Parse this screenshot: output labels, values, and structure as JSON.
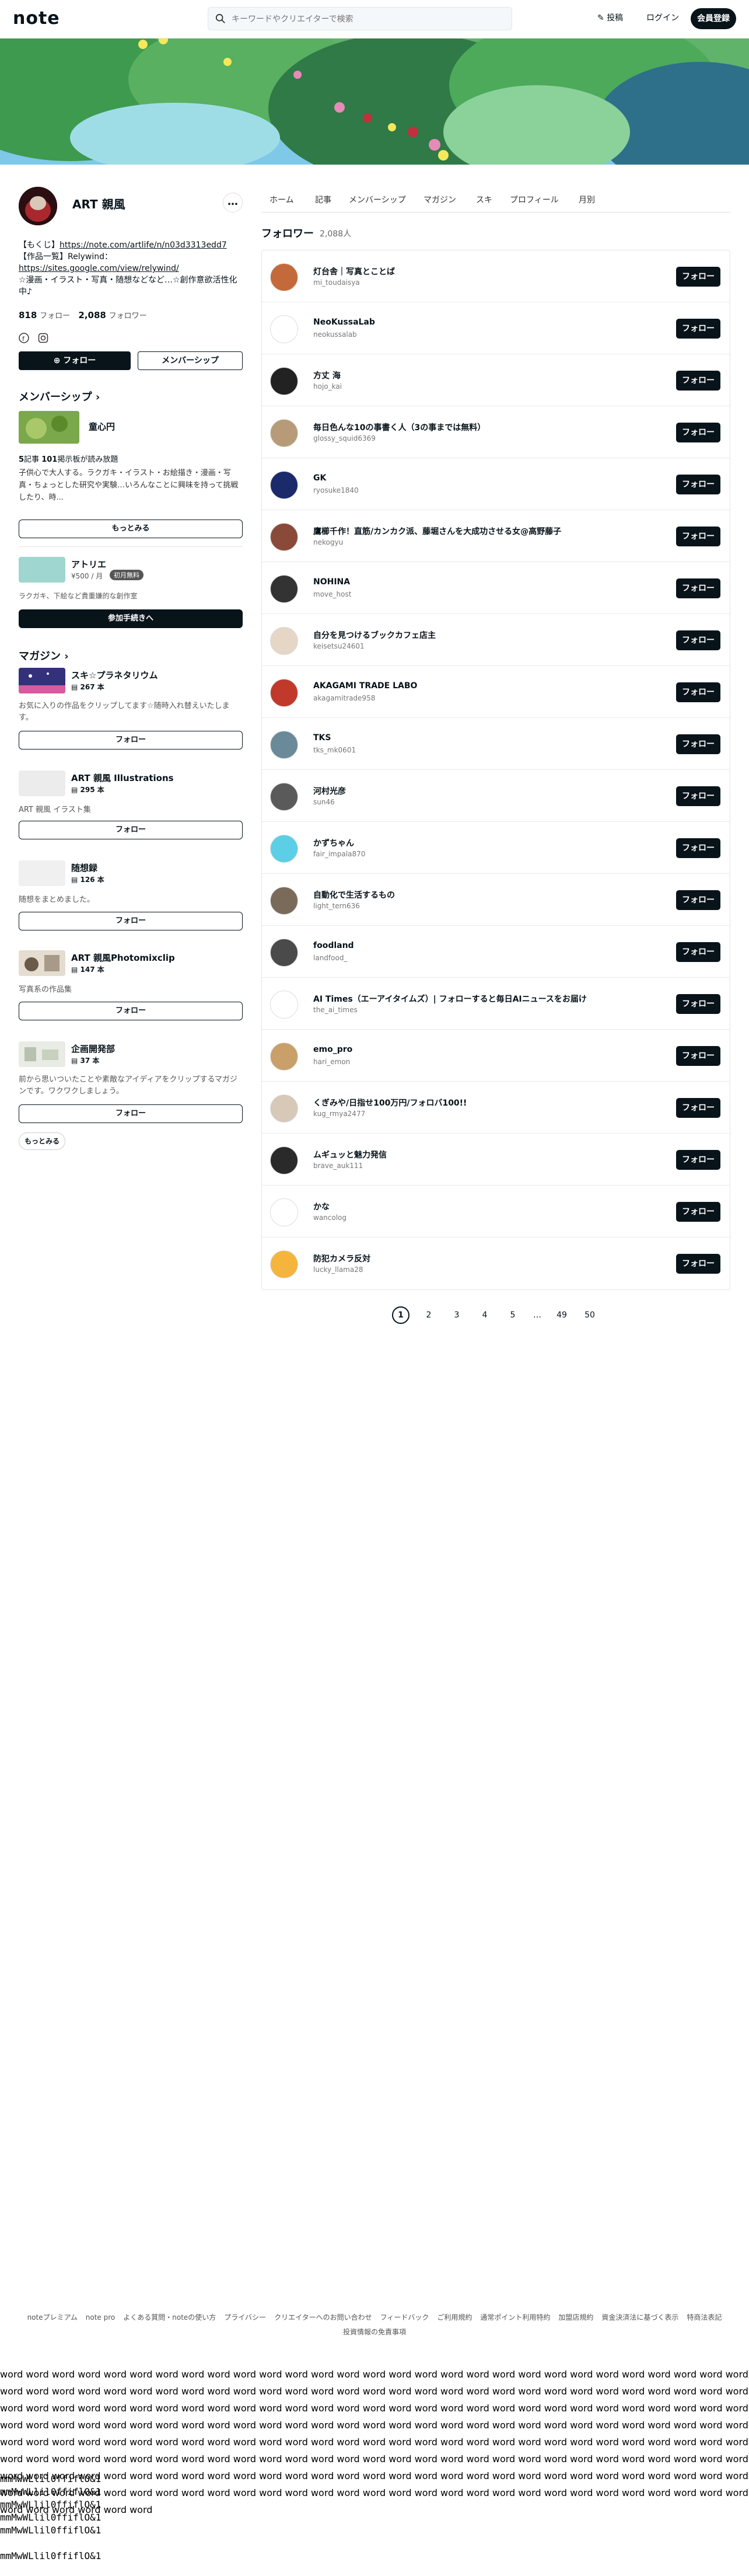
{
  "header": {
    "logo": "note",
    "search_placeholder": "キーワードやクリエイターで検索",
    "post_label": "投稿",
    "login_label": "ログイン",
    "signup_label": "会員登録"
  },
  "profile": {
    "name": "ART 親風",
    "bio_line1_prefix": "【もくじ】",
    "bio_link1": "https://note.com/artlife/n/n03d3313edd7",
    "bio_line2": "【作品一覧】Relywind：",
    "bio_link2": "https://sites.google.com/view/relywind/",
    "bio_line3": "☆漫画・イラスト・写真・随想などなど…☆創作意欲活性化中♪",
    "following_count": "818",
    "following_label": "フォロー",
    "followers_count": "2,088",
    "followers_label": "フォロワー",
    "follow_button": "フォロー",
    "membership_button": "メンバーシップ"
  },
  "membership": {
    "heading": "メンバーシップ",
    "plan_title": "童心円",
    "plan_stats_articles": "5",
    "plan_stats_articles_label": "記事",
    "plan_stats_members": "101",
    "plan_stats_members_label": "掲示板",
    "plan_stats_suffix": "が読み放題",
    "plan_desc": "子供心で大人する。ラクガキ・イラスト・お絵描き・漫画・写真・ちょっとした研究や実験…いろんなことに興味を持って挑戦したり、時...",
    "more_button": "もっとみる",
    "tier_name": "アトリエ",
    "tier_price": "¥500 / 月",
    "tier_badge": "初月無料",
    "tier_desc": "ラクガキ、下絵など貴重嫌的な創作室",
    "join_button": "参加手続きへ"
  },
  "magazines": {
    "heading": "マガジン",
    "items": [
      {
        "title": "スキ☆プラネタリウム",
        "count": "267 本",
        "desc": "お気に入りの作品をクリップしてます☆随時入れ替えいたします。",
        "follow": "フォロー"
      },
      {
        "title": "ART 親風 Illustrations",
        "count": "295 本",
        "desc": "ART 親風 イラスト集",
        "follow": "フォロー"
      },
      {
        "title": "随想録",
        "count": "126 本",
        "desc": "随想をまとめました。",
        "follow": "フォロー"
      },
      {
        "title": "ART 親風Photomixclip",
        "count": "147 本",
        "desc": "写真系の作品集",
        "follow": "フォロー"
      },
      {
        "title": "企画開発部",
        "count": "37 本",
        "desc": "前から思いついたことや素敵なアイディアをクリップするマガジンです。ワクワクしましょう。",
        "follow": "フォロー"
      }
    ],
    "more_button": "もっとみる"
  },
  "tabs": [
    "ホーム",
    "記事",
    "メンバーシップ",
    "マガジン",
    "スキ",
    "プロフィール",
    "月別"
  ],
  "followers": {
    "heading": "フォロワー",
    "count": "2,088人",
    "items": [
      {
        "name": "灯台舎｜写真とことば",
        "id": "mi_toudaisya",
        "btn": "フォロー",
        "color": "#c46a3a"
      },
      {
        "name": "NeoKussaLab",
        "id": "neokussalab",
        "btn": "フォロー",
        "color": "#ffffff"
      },
      {
        "name": "方丈 海",
        "id": "hojo_kai",
        "btn": "フォロー",
        "color": "#222222"
      },
      {
        "name": "毎日色んな10の事書く人（3の事までは無料）",
        "id": "glossy_squid6369",
        "btn": "フォロー",
        "color": "#b79b78"
      },
      {
        "name": "GK",
        "id": "ryosuke1840",
        "btn": "フォロー",
        "color": "#1a2a6a"
      },
      {
        "name": "鷹櫛千作！直筋/カンカク派、藤堀さんを大成功させる女@高野藤子",
        "id": "nekogyu",
        "btn": "フォロー",
        "color": "#8a4a3a"
      },
      {
        "name": "NOHINA",
        "id": "move_host",
        "btn": "フォロー",
        "color": "#333333"
      },
      {
        "name": "自分を見つけるブックカフェ店主",
        "id": "keisetsu24601",
        "btn": "フォロー",
        "color": "#e6d6c6"
      },
      {
        "name": "AKAGAMI TRADE LABO",
        "id": "akagamitrade958",
        "btn": "フォロー",
        "color": "#c0392b"
      },
      {
        "name": "TKS",
        "id": "tks_mk0601",
        "btn": "フォロー",
        "color": "#6a8a9a"
      },
      {
        "name": "河村光彦",
        "id": "sun46",
        "btn": "フォロー",
        "color": "#5a5a5a"
      },
      {
        "name": "かずちゃん",
        "id": "fair_impala870",
        "btn": "フォロー",
        "color": "#5ccfe6"
      },
      {
        "name": "自動化で生活するもの",
        "id": "light_tern636",
        "btn": "フォロー",
        "color": "#7a6a5a"
      },
      {
        "name": "foodland",
        "id": "landfood_",
        "btn": "フォロー",
        "color": "#4a4a4a"
      },
      {
        "name": "AI Times（エーアイタイムズ）| フォローすると毎日AIニュースをお届け",
        "id": "the_ai_times",
        "btn": "フォロー",
        "color": "#ffffff"
      },
      {
        "name": "emo_pro",
        "id": "hari_emon",
        "btn": "フォロー",
        "color": "#c9a06a"
      },
      {
        "name": "くぎみや/日指せ100万円/フォロバ100!!",
        "id": "kug_rmya2477",
        "btn": "フォロー",
        "color": "#d8c8b8"
      },
      {
        "name": "ムギュッと魅力発信",
        "id": "brave_auk111",
        "btn": "フォロー",
        "color": "#2a2a2a"
      },
      {
        "name": "かな",
        "id": "wancolog",
        "btn": "フォロー",
        "color": "#ffffff"
      },
      {
        "name": "防犯カメラ反対",
        "id": "lucky_llama28",
        "btn": "フォロー",
        "color": "#f5b53d"
      }
    ]
  },
  "pagination": [
    "1",
    "2",
    "3",
    "4",
    "5",
    "…",
    "49",
    "50"
  ],
  "footer": {
    "links": [
      "noteプレミアム",
      "note pro",
      "よくある質問・noteの使い方",
      "プライバシー",
      "クリエイターへのお問い合わせ",
      "フィードバック",
      "ご利用規約",
      "通常ポイント利用特約",
      "加盟店規約",
      "資金決済法に基づく表示",
      "特商法表記"
    ],
    "links2": [
      "投資情報の免責事項"
    ]
  },
  "filler": {
    "words": "word word word word word word word word word word word word word word word word word word word word word word word word word word word word word word word word word word word word word word word word word word word word word word word word word word word word word word word word word word word word word word word word word word word word word word word word word word word word word word word word word word word word word word word word word word word word word word word word word word word word word word word word word word word word word word word word word word word word word word word word word word word word word word word word word word word word word word word word word word word word word word word word word word word word word word word word word word word word word word word word word word word word word word word word word word word word word word word word word word word word word word word word word word word word word word word word word word word word word word word word word word word word word word word word word word word word word word word word word word word word word word word word word word word word word word word word word word word word word word",
    "mono": [
      "mmMwWLlil0ffiflO&1",
      "mmMwWLlil0ffiflO&1",
      "mmMwWLlil0ffiflO&1",
      "mmMwWLlil0ffiflO&1",
      "mmMwWLlil0ffiflO&1",
      "",
      "mmMwWLlil0ffiflO&1"
    ]
  }
}
